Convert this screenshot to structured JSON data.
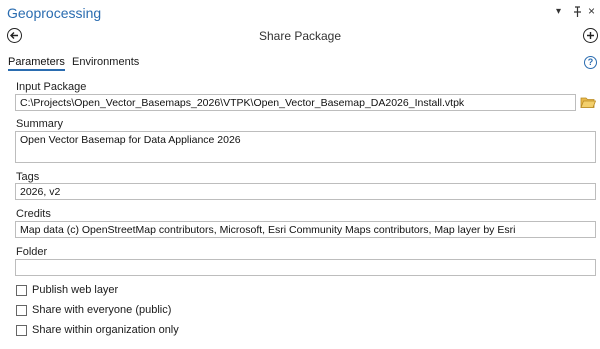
{
  "window": {
    "title": "Geoprocessing",
    "controls": [
      "chevron-down-icon",
      "pin-icon",
      "close-icon"
    ]
  },
  "nav": {
    "title": "Share Package",
    "back_icon": "back-arrow-icon",
    "add_icon": "plus-icon"
  },
  "tabs": [
    {
      "label": "Parameters",
      "active": true
    },
    {
      "label": "Environments",
      "active": false
    }
  ],
  "fields": {
    "input_package": {
      "label": "Input Package",
      "value": "C:\\Projects\\Open_Vector_Basemaps_2026\\VTPK\\Open_Vector_Basemap_DA2026_Install.vtpk"
    },
    "summary": {
      "label": "Summary",
      "value": "Open Vector Basemap for Data Appliance 2026"
    },
    "tags": {
      "label": "Tags",
      "value": "2026, v2"
    },
    "credits": {
      "label": "Credits",
      "value": "Map data (c) OpenStreetMap contributors, Microsoft, Esri Community Maps contributors, Map layer by Esri"
    },
    "folder": {
      "label": "Folder",
      "value": ""
    }
  },
  "checkboxes": [
    {
      "label": "Publish web layer",
      "checked": false
    },
    {
      "label": "Share with everyone (public)",
      "checked": false
    },
    {
      "label": "Share within organization only",
      "checked": false
    }
  ],
  "colors": {
    "accent": "#2a6cb0",
    "folder_icon": "#e8b84a"
  }
}
